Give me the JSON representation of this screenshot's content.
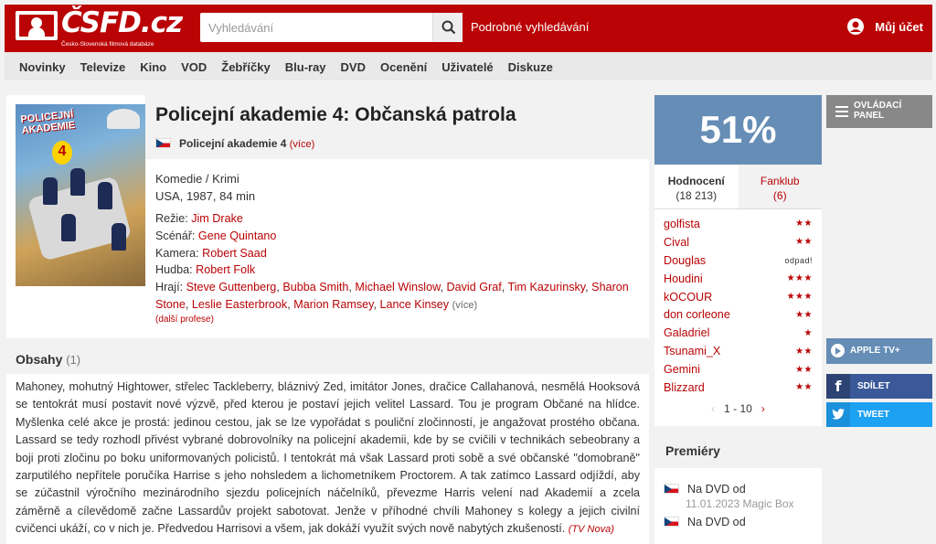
{
  "header": {
    "logo_text": "ČSFD.cz",
    "logo_subtitle": "Česko-Slovenská filmová databáze",
    "search_placeholder": "Vyhledávání",
    "advanced_search": "Podrobné vyhledávání",
    "account": "Můj účet"
  },
  "nav": [
    "Novinky",
    "Televize",
    "Kino",
    "VOD",
    "Žebříčky",
    "Blu-ray",
    "DVD",
    "Ocenění",
    "Uživatelé",
    "Diskuze"
  ],
  "film": {
    "title": "Policejní akademie 4: Občanská patrola",
    "alt_title": "Policejní akademie 4",
    "alt_more": "(více)",
    "poster_title": "POLICEJNÍ AKADEMIE",
    "poster_number": "4",
    "genre": "Komedie / Krimi",
    "origin": "USA, 1987, 84 min",
    "director_label": "Režie:",
    "director": "Jim Drake",
    "writer_label": "Scénář:",
    "writer": "Gene Quintano",
    "camera_label": "Kamera:",
    "camera": "Robert Saad",
    "music_label": "Hudba:",
    "music": "Robert Folk",
    "cast_label": "Hrají:",
    "cast": [
      "Steve Guttenberg",
      "Bubba Smith",
      "Michael Winslow",
      "David Graf",
      "Tim Kazurinsky",
      "Sharon Stone",
      "Leslie Easterbrook",
      "Marion Ramsey",
      "Lance Kinsey"
    ],
    "cast_more": "(více)",
    "more_professions": "(další profese)"
  },
  "content": {
    "heading": "Obsahy",
    "count": "(1)",
    "text": "Mahoney, mohutný Hightower, střelec Tackleberry, bláznivý Zed, imitátor Jones, dračice Callahanová, nesmělá Hooksová se tentokrát musí postavit nové výzvě, před kterou je postaví jejich velitel Lassard. Tou je program Občané na hlídce. Myšlenka celé akce je prostá: jedinou cestou, jak se lze vypořádat s pouliční zločinností, je angažovat prostého občana. Lassard se tedy rozhodl přivést vybrané dobrovolníky na policejní akademii, kde by se cvičili v technikách sebeobrany a boji proti zločinu po boku uniformovaných policistů. I tentokrát má však Lassard proti sobě a své občanské \"domobraně\" zarputilého nepřítele poručíka Harrise s jeho nohsledem a lichometníkem Proctorem. A tak zatímco Lassard odjíždí, aby se zúčastnil výročního mezinárodního sjezdu policejních náčelníků, převezme Harris velení nad Akademií a zcela záměrně a cílevědomě začne Lassardův projekt sabotovat. Jenže v příhodné chvíli Mahoney s kolegy a jejich civilní cvičenci ukáží, co v nich je. Předvedou Harrisovi a všem, jak dokáží využít svých nově nabytých zkušeností.",
    "source": "(TV Nova)"
  },
  "rating": {
    "percent": "51%",
    "accent_color": "#658db5",
    "tab_ratings": "Hodnocení",
    "tab_ratings_count": "(18 213)",
    "tab_fanclub": "Fanklub",
    "tab_fanclub_count": "(6)",
    "users": [
      {
        "name": "golfista",
        "stars": "★★"
      },
      {
        "name": "Cival",
        "stars": "★★"
      },
      {
        "name": "Douglas",
        "stars": "odpad!"
      },
      {
        "name": "Houdini",
        "stars": "★★★"
      },
      {
        "name": "kOCOUR",
        "stars": "★★★"
      },
      {
        "name": "don corleone",
        "stars": "★★"
      },
      {
        "name": "Galadriel",
        "stars": "★"
      },
      {
        "name": "Tsunami_X",
        "stars": "★★"
      },
      {
        "name": "Gemini",
        "stars": "★★"
      },
      {
        "name": "Blizzard",
        "stars": "★★"
      }
    ],
    "pager": "1 - 10"
  },
  "premieres": {
    "heading": "Premiéry",
    "items": [
      {
        "label": "Na DVD od",
        "date": "11.01.2023 Magic Box"
      },
      {
        "label": "Na DVD od",
        "date": ""
      }
    ]
  },
  "side": {
    "control_panel": "OVLÁDACÍ PANEL",
    "apple_tv": "APPLE TV+",
    "share": "SDÍLET",
    "tweet": "TWEET"
  }
}
